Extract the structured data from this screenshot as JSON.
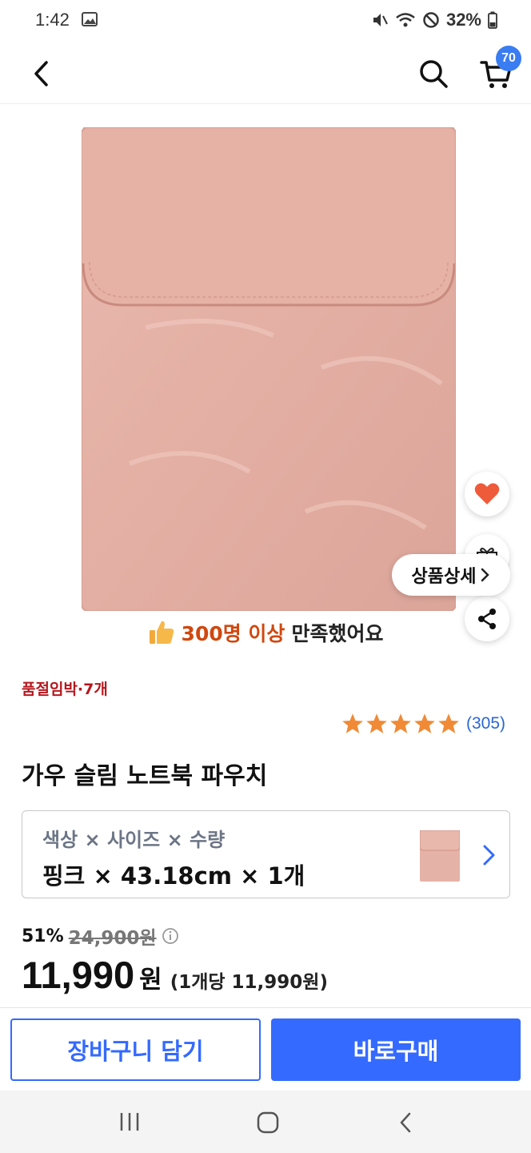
{
  "status_bar": {
    "time": "1:42",
    "battery": "32%",
    "icons": [
      "gallery-icon",
      "mute-icon",
      "wifi-icon",
      "do-not-disturb-icon",
      "battery-icon"
    ]
  },
  "header": {
    "cart_count": "70",
    "icons": [
      "back-arrow-icon",
      "search-icon",
      "cart-icon"
    ]
  },
  "product": {
    "image_color": "#e5b2a7",
    "satisfaction_highlight": "300명 이상",
    "satisfaction_rest": "만족했어요",
    "stock_alert": "품절임박·7개",
    "rating": 5,
    "review_count": "(305)",
    "title": "가우 슬림 노트북 파우치",
    "detail_label": "상품상세"
  },
  "option": {
    "label": "색상 × 사이즈 × 수량",
    "value": "핑크 × 43.18cm × 1개"
  },
  "price": {
    "discount_rate": "51%",
    "original_price": "24,900원",
    "sale_price": "11,990",
    "currency": "원",
    "unit_price": "(1개당 11,990원)"
  },
  "actions": {
    "add_to_cart": "장바구니 담기",
    "buy_now": "바로구매"
  },
  "colors": {
    "accent": "#346aff",
    "badge": "#3a7cf2",
    "highlight": "#d0480f",
    "alert": "#b5181e",
    "star": "#f08a36",
    "heart": "#ee5b3b"
  }
}
